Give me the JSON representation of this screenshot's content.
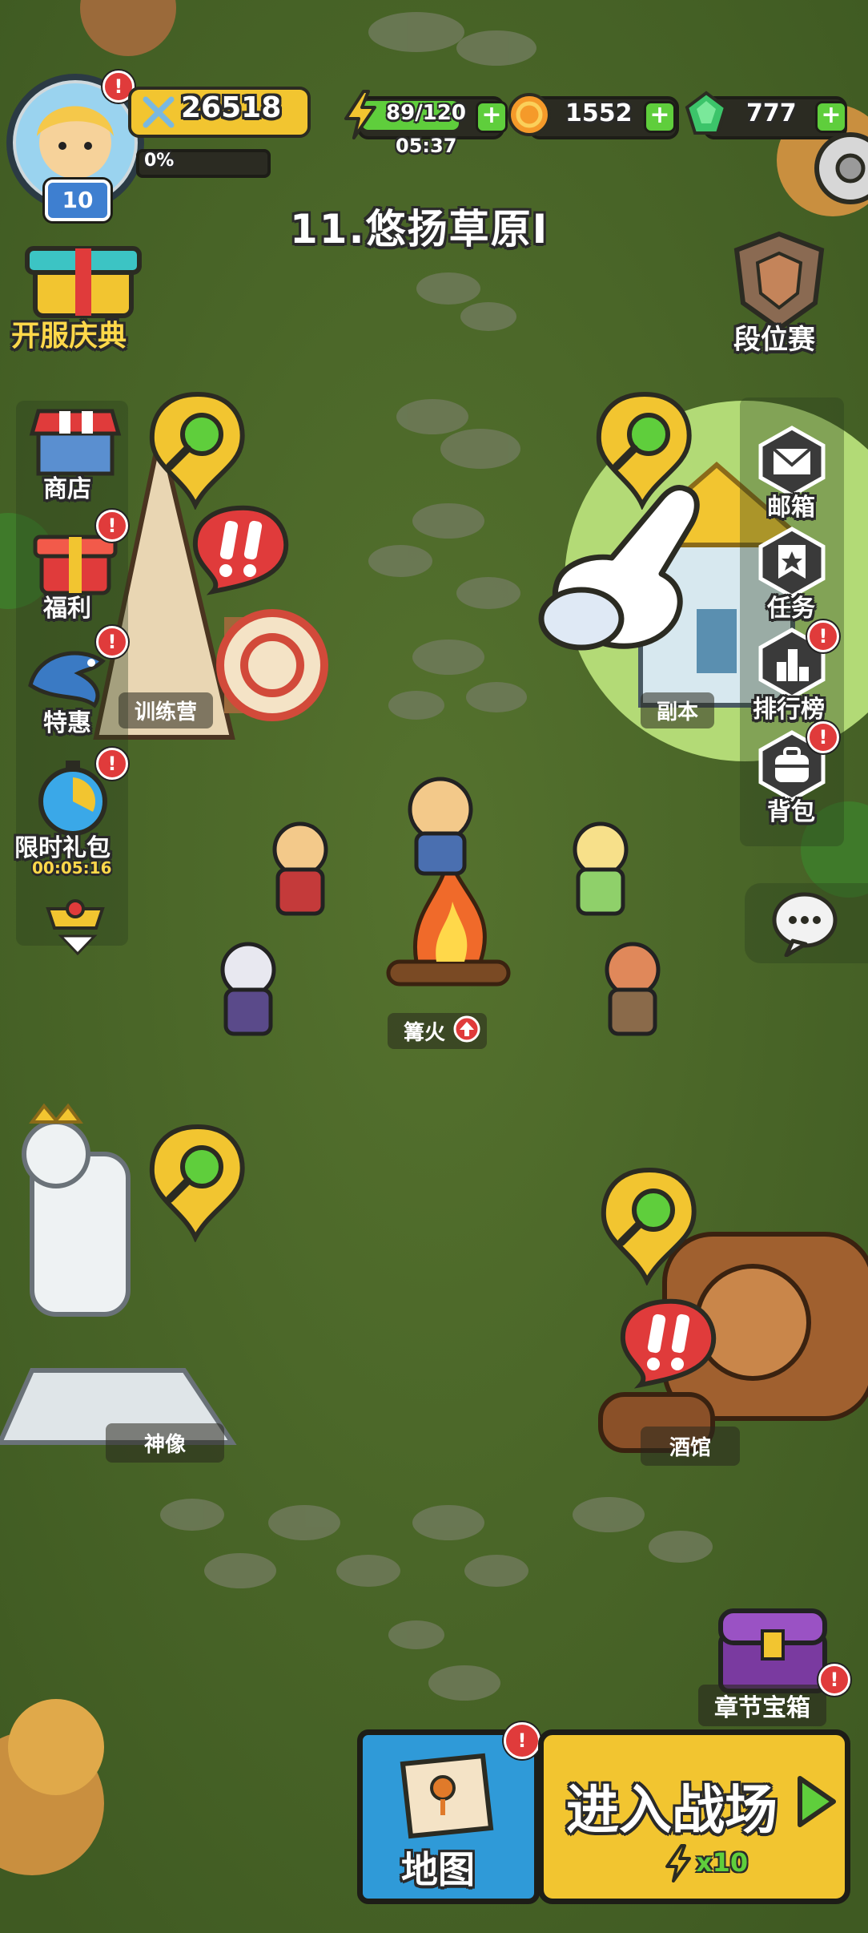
{
  "player": {
    "level": "10",
    "power": "26518",
    "exp_percent": "0%",
    "exp_fraction": 0
  },
  "resources": {
    "energy": "89/120",
    "energy_fraction": 0.74,
    "energy_timer": "05:37",
    "gold": "1552",
    "gems": "777"
  },
  "stage_title": "11.悠扬草原I",
  "left_menu": {
    "event": "开服庆典",
    "shop": "商店",
    "welfare": "福利",
    "special": "特惠",
    "limited_pack": "限时礼包",
    "limited_timer": "00:05:16"
  },
  "right_menu": {
    "ranked": "段位赛",
    "mail": "邮箱",
    "quest": "任务",
    "leaderboard": "排行榜",
    "bag": "背包"
  },
  "buildings": {
    "training": "训练营",
    "dungeon": "副本",
    "bonfire": "篝火",
    "statue": "神像",
    "tavern": "酒馆"
  },
  "chapter_chest": "章节宝箱",
  "bottom": {
    "map": "地图",
    "enter_battle": "进入战场",
    "battle_cost": "x10"
  },
  "colors": {
    "grass": "#4f6b2a",
    "highlight": "#b8e07a",
    "gold_yellow": "#f2c530",
    "energy_green": "#5fce3c",
    "alert_red": "#e03b3b"
  }
}
